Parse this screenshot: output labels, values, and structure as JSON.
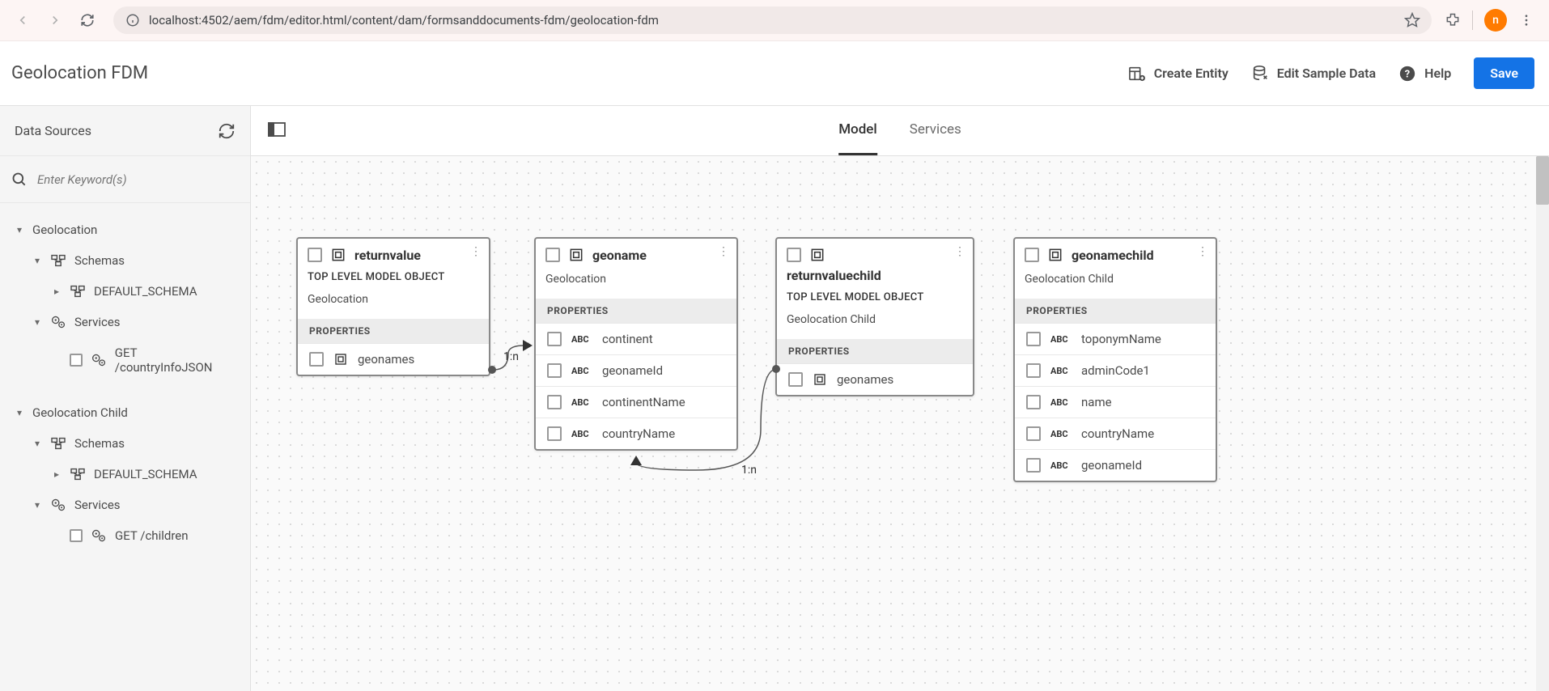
{
  "browser": {
    "url_display": "localhost:4502/aem/fdm/editor.html/content/dam/formsanddocuments-fdm/geolocation-fdm",
    "avatar_letter": "n"
  },
  "header": {
    "title": "Geolocation FDM",
    "create_entity": "Create Entity",
    "edit_sample": "Edit Sample Data",
    "help": "Help",
    "save": "Save"
  },
  "sidebar": {
    "title": "Data Sources",
    "search_placeholder": "Enter Keyword(s)",
    "sources": [
      {
        "name": "Geolocation",
        "schemas_label": "Schemas",
        "default_schema": "DEFAULT_SCHEMA",
        "services_label": "Services",
        "service_name": "GET /countryInfoJSON"
      },
      {
        "name": "Geolocation Child",
        "schemas_label": "Schemas",
        "default_schema": "DEFAULT_SCHEMA",
        "services_label": "Services",
        "service_name": "GET /children"
      }
    ]
  },
  "tabs": {
    "model": "Model",
    "services": "Services"
  },
  "entities": [
    {
      "id": "returnvalue",
      "title": "returnvalue",
      "top_level": "TOP LEVEL MODEL OBJECT",
      "source": "Geolocation",
      "props_header": "PROPERTIES",
      "props": [
        {
          "type_label": "OBJ",
          "name": "geonames"
        }
      ]
    },
    {
      "id": "geoname",
      "title": "geoname",
      "source": "Geolocation",
      "props_header": "PROPERTIES",
      "props": [
        {
          "type_label": "ABC",
          "name": "continent"
        },
        {
          "type_label": "ABC",
          "name": "geonameId"
        },
        {
          "type_label": "ABC",
          "name": "continentName"
        },
        {
          "type_label": "ABC",
          "name": "countryName"
        }
      ]
    },
    {
      "id": "returnvaluechild",
      "title": "returnvaluechild",
      "top_level": "TOP LEVEL MODEL OBJECT",
      "source": "Geolocation Child",
      "props_header": "PROPERTIES",
      "props": [
        {
          "type_label": "OBJ",
          "name": "geonames"
        }
      ]
    },
    {
      "id": "geonamechild",
      "title": "geonamechild",
      "source": "Geolocation Child",
      "props_header": "PROPERTIES",
      "props": [
        {
          "type_label": "ABC",
          "name": "toponymName"
        },
        {
          "type_label": "ABC",
          "name": "adminCode1"
        },
        {
          "type_label": "ABC",
          "name": "name"
        },
        {
          "type_label": "ABC",
          "name": "countryName"
        },
        {
          "type_label": "ABC",
          "name": "geonameId"
        }
      ]
    }
  ],
  "relations": {
    "one_to_n": "1:n"
  }
}
